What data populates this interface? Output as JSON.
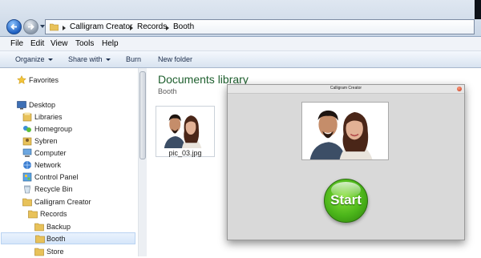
{
  "address": {
    "crumbs": [
      "Calligram Creator",
      "Records",
      "Booth"
    ]
  },
  "menu": [
    "File",
    "Edit",
    "View",
    "Tools",
    "Help"
  ],
  "toolbar": {
    "organize": "Organize",
    "share": "Share with",
    "burn": "Burn",
    "new_folder": "New folder"
  },
  "nav": {
    "favorites": "Favorites",
    "desktop": "Desktop",
    "libraries": "Libraries",
    "homegroup": "Homegroup",
    "user": "Sybren",
    "computer": "Computer",
    "network": "Network",
    "control_panel": "Control Panel",
    "recycle_bin": "Recycle Bin",
    "calligram": "Calligram Creator",
    "records": "Records",
    "backup": "Backup",
    "booth": "Booth",
    "store": "Store"
  },
  "library": {
    "title": "Documents library",
    "subtitle": "Booth"
  },
  "file": {
    "name": "pic_03.jpg"
  },
  "app": {
    "title": "Calligram Creator",
    "start_label": "Start",
    "accent": "#4bb51a"
  }
}
